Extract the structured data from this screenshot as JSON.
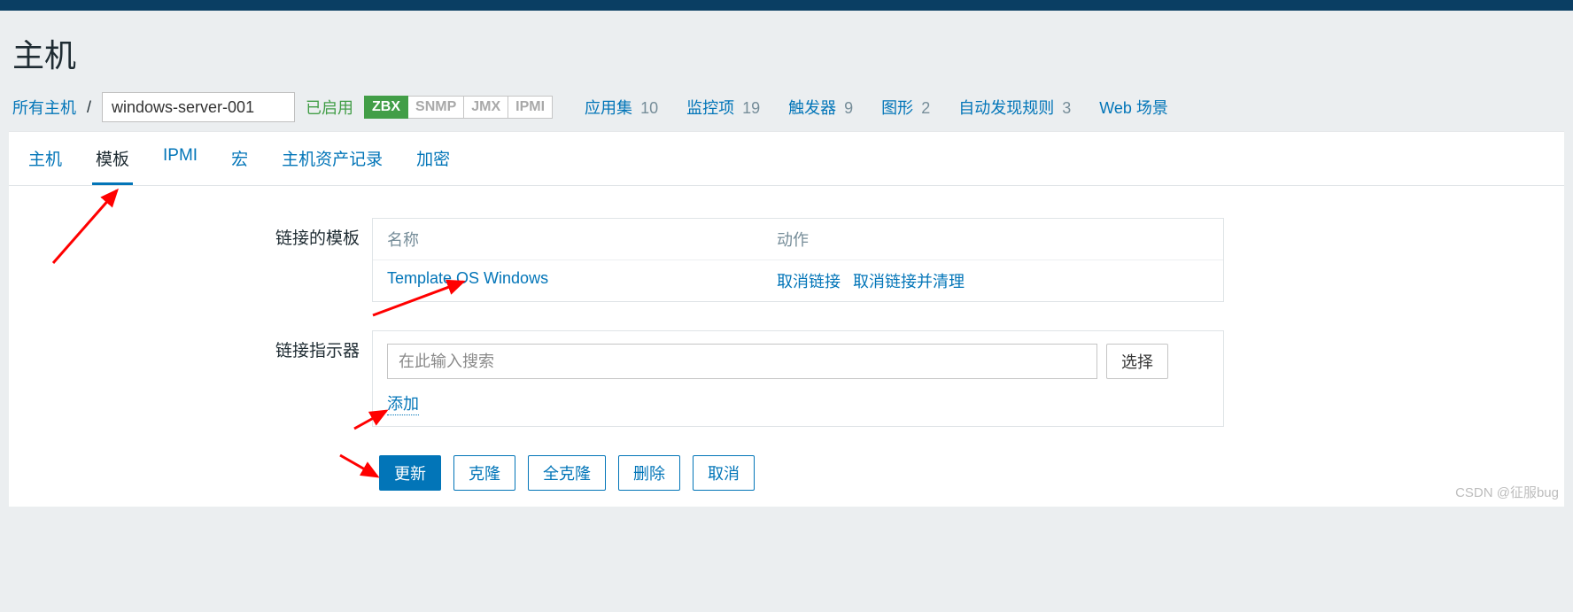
{
  "page": {
    "title": "主机"
  },
  "breadcrumb": {
    "all_hosts": "所有主机",
    "sep": "/",
    "host_name": "windows-server-001",
    "status": "已启用"
  },
  "badges": {
    "zbx": "ZBX",
    "snmp": "SNMP",
    "jmx": "JMX",
    "ipmi": "IPMI"
  },
  "stats": {
    "apps_label": "应用集",
    "apps_count": "10",
    "items_label": "监控项",
    "items_count": "19",
    "triggers_label": "触发器",
    "triggers_count": "9",
    "graphs_label": "图形",
    "graphs_count": "2",
    "discovery_label": "自动发现规则",
    "discovery_count": "3",
    "web_label": "Web 场景"
  },
  "tabs": {
    "host": "主机",
    "templates": "模板",
    "ipmi": "IPMI",
    "macros": "宏",
    "inventory": "主机资产记录",
    "encryption": "加密"
  },
  "linked_templates": {
    "label": "链接的模板",
    "col_name": "名称",
    "col_action": "动作",
    "rows": [
      {
        "name": "Template OS Windows",
        "unlink": "取消链接",
        "unlink_clear": "取消链接并清理"
      }
    ]
  },
  "link_new": {
    "label": "链接指示器",
    "placeholder": "在此输入搜索",
    "select": "选择",
    "add": "添加"
  },
  "buttons": {
    "update": "更新",
    "clone": "克隆",
    "full_clone": "全克隆",
    "delete": "删除",
    "cancel": "取消"
  },
  "watermark": "CSDN @征服bug"
}
